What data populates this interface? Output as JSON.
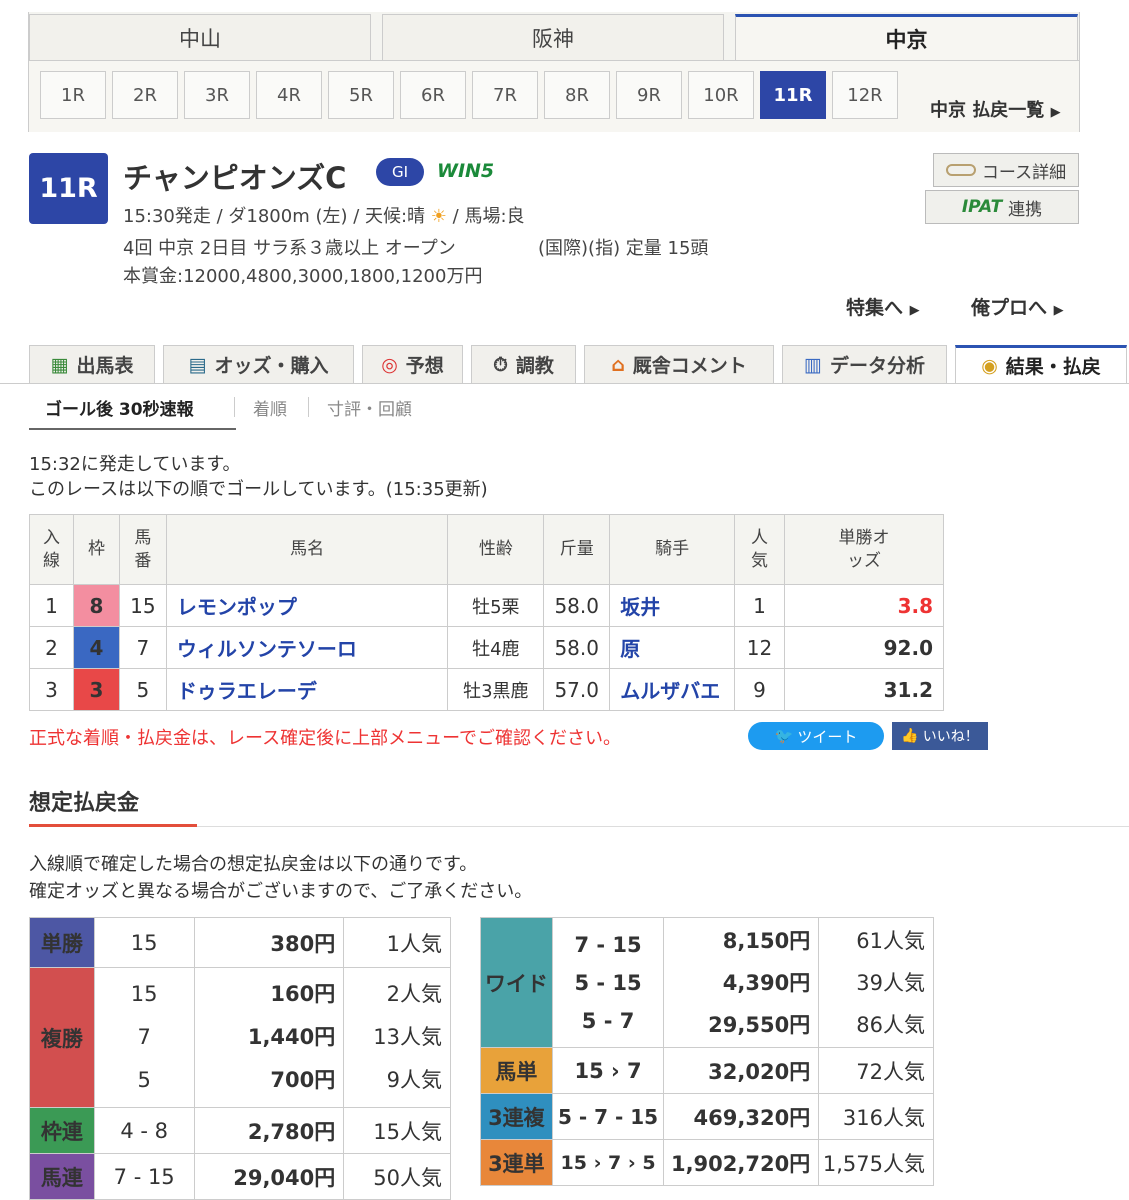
{
  "venues": [
    "中山",
    "阪神",
    "中京"
  ],
  "races": [
    "1R",
    "2R",
    "3R",
    "4R",
    "5R",
    "6R",
    "7R",
    "8R",
    "9R",
    "10R",
    "11R",
    "12R"
  ],
  "harai_link": "中京 払戻一覧",
  "race": {
    "no": "11R",
    "name": "チャンピオンズC",
    "grade": "GI",
    "win5": "WIN5",
    "line1": "15:30発走 / ダ1800m (左) / 天候:晴",
    "line1b": "/ 馬場:良",
    "line2": "4回 中京 2日目 サラ系３歳以上 オープン",
    "line2b": "(国際)(指) 定量 15頭",
    "line3": "本賞金:12000,4800,3000,1800,1200万円"
  },
  "side_buttons": {
    "course": "コース詳細",
    "ipat": "IPAT",
    "ipat2": "連携"
  },
  "feature_links": [
    "特集へ",
    "俺プロへ"
  ],
  "tabs": [
    "出馬表",
    "オッズ・購入",
    "予想",
    "調教",
    "厩舎コメント",
    "データ分析",
    "結果・払戻"
  ],
  "subtabs": [
    "ゴール後 30秒速報",
    "着順",
    "寸評・回顧"
  ],
  "status": [
    "15:32に発走しています。",
    "このレースは以下の順でゴールしています。(15:35更新)"
  ],
  "table_head": [
    "入線",
    "枠",
    "馬番",
    "馬名",
    "性齢",
    "斤量",
    "騎手",
    "人気",
    "単勝オッズ"
  ],
  "results": [
    {
      "pos": "1",
      "waku": "8",
      "num": "15",
      "horse": "レモンポップ",
      "sex": "牡5栗",
      "weight": "58.0",
      "jockey": "坂井",
      "pop": "1",
      "odds": "3.8"
    },
    {
      "pos": "2",
      "waku": "4",
      "num": "7",
      "horse": "ウィルソンテソーロ",
      "sex": "牡4鹿",
      "weight": "58.0",
      "jockey": "原",
      "pop": "12",
      "odds": "92.0"
    },
    {
      "pos": "3",
      "waku": "3",
      "num": "5",
      "horse": "ドゥラエレーデ",
      "sex": "牡3黒鹿",
      "weight": "57.0",
      "jockey": "ムルザバエ",
      "pop": "9",
      "odds": "31.2"
    }
  ],
  "waku_colors": {
    "8": "#f38ea0",
    "4": "#3a68c2",
    "3": "#e84848"
  },
  "notice": "正式な着順・払戻金は、レース確定後に上部メニューでご確認ください。",
  "tweet": "ツイート",
  "like": "いいね！",
  "section": "想定払戻金",
  "desc": [
    "入線順で確定した場合の想定払戻金は以下の通りです。",
    "確定オッズと異なる場合がございますので、ご了承ください。"
  ],
  "payout_left": [
    {
      "label": "単勝",
      "color": "#4d57a4",
      "rows": [
        [
          "15",
          "380円",
          "1人気"
        ]
      ]
    },
    {
      "label": "複勝",
      "color": "#d24f4f",
      "rows": [
        [
          "15",
          "160円",
          "2人気"
        ],
        [
          "7",
          "1,440円",
          "13人気"
        ],
        [
          "5",
          "700円",
          "9人気"
        ]
      ]
    },
    {
      "label": "枠連",
      "color": "#3b9a55",
      "rows": [
        [
          "4 - 8",
          "2,780円",
          "15人気"
        ]
      ]
    },
    {
      "label": "馬連",
      "color": "#7a4fa0",
      "rows": [
        [
          "7 - 15",
          "29,040円",
          "50人気"
        ]
      ]
    }
  ],
  "payout_right": [
    {
      "label": "ワイド",
      "color": "#4aa3a8",
      "rows": [
        [
          "7 - 15",
          "8,150円",
          "61人気"
        ],
        [
          "5 - 15",
          "4,390円",
          "39人気"
        ],
        [
          "5 - 7",
          "29,550円",
          "86人気"
        ]
      ]
    },
    {
      "label": "馬単",
      "color": "#e8a23a",
      "rows": [
        [
          "15 › 7",
          "32,020円",
          "72人気"
        ]
      ]
    },
    {
      "label": "3連複",
      "color": "#2f8fbf",
      "rows": [
        [
          "5 - 7 - 15",
          "469,320円",
          "316人気"
        ]
      ]
    },
    {
      "label": "3連単",
      "color": "#e8873a",
      "rows": [
        [
          "15 › 7 › 5",
          "1,902,720円",
          "1,575人気"
        ]
      ]
    }
  ]
}
